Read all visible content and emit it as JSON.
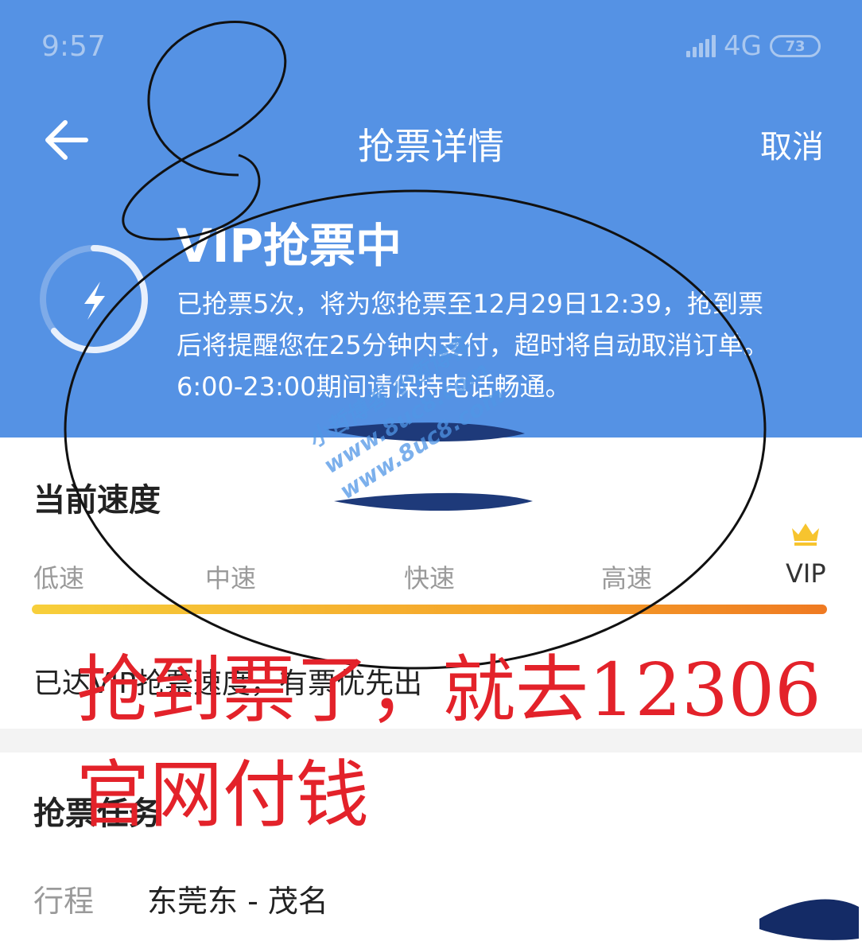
{
  "status_bar": {
    "time": "9:57",
    "network": "4G",
    "battery": "73"
  },
  "header": {
    "title": "抢票详情",
    "cancel_label": "取消"
  },
  "grab": {
    "heading": "VIP抢票中",
    "desc_lines": [
      "已抢票5次，将为您抢票至12月29日12:39，抢到票",
      "后将提醒您在25分钟内支付，超时将自动取消订单。",
      "6:00-23:00期间请保持电话畅通。"
    ]
  },
  "speed": {
    "title": "当前速度",
    "levels": [
      "低速",
      "中速",
      "快速",
      "高速",
      "VIP"
    ],
    "current_level": "VIP",
    "note": "已达VIP抢票速度，有票优先出"
  },
  "task": {
    "title": "抢票任务",
    "route_label": "行程",
    "route_value": "东莞东 - 茂名"
  },
  "annotation": {
    "line1": "抢到票了，就去12306",
    "line2": "官网付钱",
    "color": "#e3222a"
  },
  "watermark": {
    "lines": [
      "小哲博客 小哲博客",
      "www.8uc8.com",
      "www.8uc8.com"
    ]
  },
  "colors": {
    "header_bg": "#5592e4",
    "bar_start": "#f7cf3b",
    "bar_end": "#ef7a22"
  },
  "icons": {
    "back": "back-arrow-icon",
    "lightning": "lightning-icon",
    "crown": "crown-icon"
  }
}
